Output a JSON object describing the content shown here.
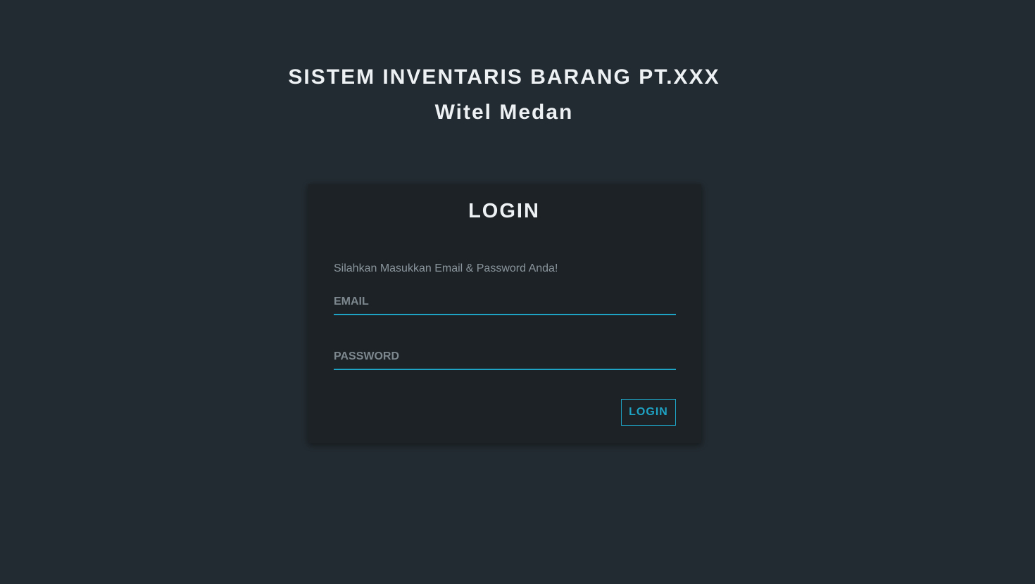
{
  "header": {
    "title": "SISTEM INVENTARIS BARANG PT.XXX",
    "subtitle": "Witel Medan"
  },
  "login_card": {
    "title": "LOGIN",
    "instruction": "Silahkan Masukkan Email & Password Anda!",
    "email_placeholder": "EMAIL",
    "email_value": "",
    "password_placeholder": "PASSWORD",
    "password_value": "",
    "button_label": "LOGIN"
  },
  "colors": {
    "background": "#222b31",
    "card": "#1c2226",
    "accent": "#1fa3c4",
    "text": "#eef1f3",
    "muted": "#8a959c"
  }
}
